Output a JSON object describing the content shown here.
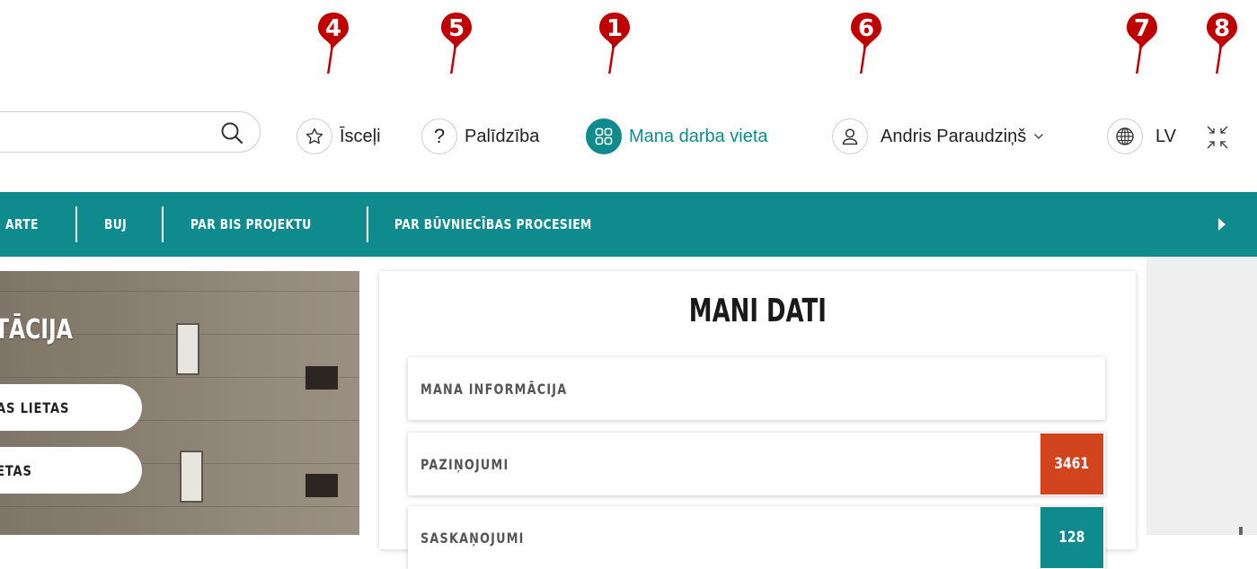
{
  "header": {
    "search": {
      "value": "",
      "placeholder": ""
    },
    "favorites_label": "Īsceļi",
    "help_label": "Palīdzība",
    "workspace_label": "Mana darba vieta",
    "user_name": "Andris Paraudziņš",
    "language_label": "LV"
  },
  "markers": [
    {
      "num": "4",
      "target": "favorites"
    },
    {
      "num": "5",
      "target": "help"
    },
    {
      "num": "1",
      "target": "workspace"
    },
    {
      "num": "6",
      "target": "user"
    },
    {
      "num": "7",
      "target": "language"
    },
    {
      "num": "8",
      "target": "collapse"
    }
  ],
  "nav": {
    "items": [
      {
        "label": "ARTE"
      },
      {
        "label": "BUJ"
      },
      {
        "label": "PAR BIS PROJEKTU"
      },
      {
        "label": "PAR BŪVNIECĪBAS PROCESIEM"
      }
    ]
  },
  "hero": {
    "title": "TĀCIJA",
    "buttons": [
      {
        "label": "AS LIETAS"
      },
      {
        "label": "ETAS"
      }
    ]
  },
  "panel": {
    "title": "MANI DATI",
    "items": [
      {
        "label": "MANA INFORMĀCIJA",
        "badge": ""
      },
      {
        "label": "PAZIŅOJUMI",
        "badge": "3461"
      },
      {
        "label": "SASKAŅOJUMI",
        "badge": "128"
      }
    ]
  },
  "colors": {
    "brand_teal": "#0f8b8d",
    "marker_red": "#c00000",
    "badge_orange": "#d2441e",
    "badge_teal": "#0f8b8d"
  }
}
